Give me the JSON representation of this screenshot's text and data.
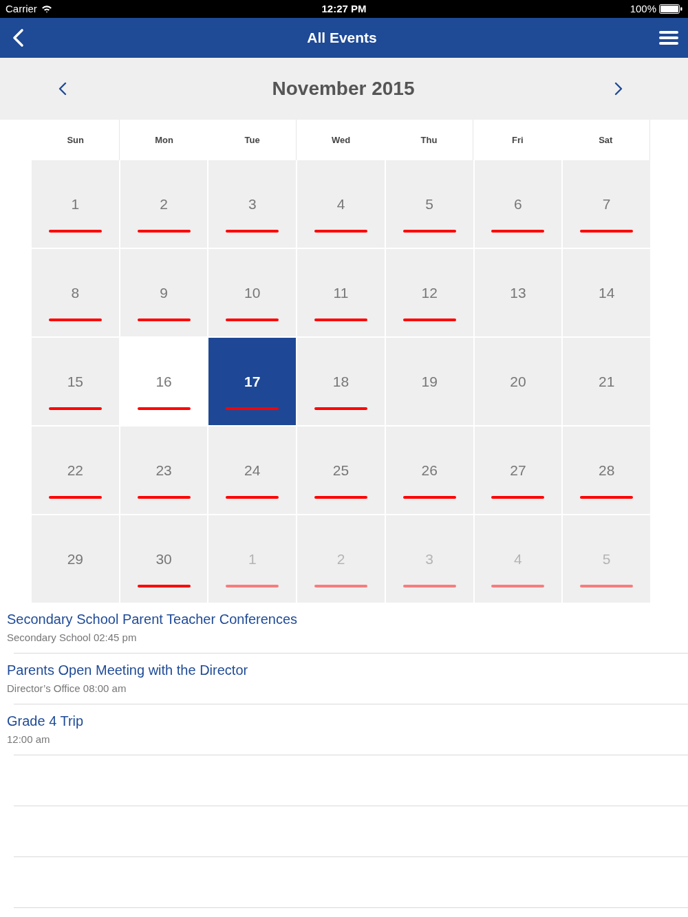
{
  "status_bar": {
    "carrier": "Carrier",
    "time": "12:27 PM",
    "battery": "100%"
  },
  "nav_bar": {
    "title": "All Events"
  },
  "calendar": {
    "month": "November 2015",
    "weekdays": [
      "Sun",
      "Mon",
      "Tue",
      "Wed",
      "Thu",
      "Fri",
      "Sat"
    ],
    "weeks": [
      [
        {
          "day": "1",
          "in_month": true,
          "has_events": true,
          "today": false,
          "selected": false
        },
        {
          "day": "2",
          "in_month": true,
          "has_events": true,
          "today": false,
          "selected": false
        },
        {
          "day": "3",
          "in_month": true,
          "has_events": true,
          "today": false,
          "selected": false
        },
        {
          "day": "4",
          "in_month": true,
          "has_events": true,
          "today": false,
          "selected": false
        },
        {
          "day": "5",
          "in_month": true,
          "has_events": true,
          "today": false,
          "selected": false
        },
        {
          "day": "6",
          "in_month": true,
          "has_events": true,
          "today": false,
          "selected": false
        },
        {
          "day": "7",
          "in_month": true,
          "has_events": true,
          "today": false,
          "selected": false
        }
      ],
      [
        {
          "day": "8",
          "in_month": true,
          "has_events": true,
          "today": false,
          "selected": false
        },
        {
          "day": "9",
          "in_month": true,
          "has_events": true,
          "today": false,
          "selected": false
        },
        {
          "day": "10",
          "in_month": true,
          "has_events": true,
          "today": false,
          "selected": false
        },
        {
          "day": "11",
          "in_month": true,
          "has_events": true,
          "today": false,
          "selected": false
        },
        {
          "day": "12",
          "in_month": true,
          "has_events": true,
          "today": false,
          "selected": false
        },
        {
          "day": "13",
          "in_month": true,
          "has_events": false,
          "today": false,
          "selected": false
        },
        {
          "day": "14",
          "in_month": true,
          "has_events": false,
          "today": false,
          "selected": false
        }
      ],
      [
        {
          "day": "15",
          "in_month": true,
          "has_events": true,
          "today": false,
          "selected": false
        },
        {
          "day": "16",
          "in_month": true,
          "has_events": true,
          "today": true,
          "selected": false
        },
        {
          "day": "17",
          "in_month": true,
          "has_events": true,
          "today": false,
          "selected": true
        },
        {
          "day": "18",
          "in_month": true,
          "has_events": true,
          "today": false,
          "selected": false
        },
        {
          "day": "19",
          "in_month": true,
          "has_events": false,
          "today": false,
          "selected": false
        },
        {
          "day": "20",
          "in_month": true,
          "has_events": false,
          "today": false,
          "selected": false
        },
        {
          "day": "21",
          "in_month": true,
          "has_events": false,
          "today": false,
          "selected": false
        }
      ],
      [
        {
          "day": "22",
          "in_month": true,
          "has_events": true,
          "today": false,
          "selected": false
        },
        {
          "day": "23",
          "in_month": true,
          "has_events": true,
          "today": false,
          "selected": false
        },
        {
          "day": "24",
          "in_month": true,
          "has_events": true,
          "today": false,
          "selected": false
        },
        {
          "day": "25",
          "in_month": true,
          "has_events": true,
          "today": false,
          "selected": false
        },
        {
          "day": "26",
          "in_month": true,
          "has_events": true,
          "today": false,
          "selected": false
        },
        {
          "day": "27",
          "in_month": true,
          "has_events": true,
          "today": false,
          "selected": false
        },
        {
          "day": "28",
          "in_month": true,
          "has_events": true,
          "today": false,
          "selected": false
        }
      ],
      [
        {
          "day": "29",
          "in_month": true,
          "has_events": false,
          "today": false,
          "selected": false
        },
        {
          "day": "30",
          "in_month": true,
          "has_events": true,
          "today": false,
          "selected": false
        },
        {
          "day": "1",
          "in_month": false,
          "has_events": true,
          "today": false,
          "selected": false
        },
        {
          "day": "2",
          "in_month": false,
          "has_events": true,
          "today": false,
          "selected": false
        },
        {
          "day": "3",
          "in_month": false,
          "has_events": true,
          "today": false,
          "selected": false
        },
        {
          "day": "4",
          "in_month": false,
          "has_events": true,
          "today": false,
          "selected": false
        },
        {
          "day": "5",
          "in_month": false,
          "has_events": true,
          "today": false,
          "selected": false
        }
      ]
    ]
  },
  "events": [
    {
      "title": "Secondary School Parent Teacher Conferences",
      "detail": "Secondary School 02:45 pm"
    },
    {
      "title": "Parents Open Meeting with the Director",
      "detail": "Director’s Office 08:00 am"
    },
    {
      "title": "Grade 4 Trip",
      "detail": "12:00 am"
    }
  ]
}
